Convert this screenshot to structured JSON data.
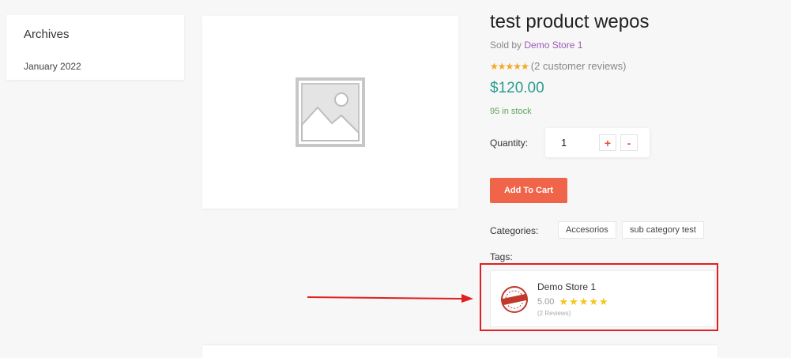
{
  "sidebar": {
    "title": "Archives",
    "items": [
      {
        "label": "January 2022"
      }
    ]
  },
  "product": {
    "title": "test product wepos",
    "sold_by_prefix": "Sold by",
    "vendor_link": "Demo Store 1",
    "rating_stars": 5,
    "reviews_text": "(2 customer reviews)",
    "price": "$120.00",
    "stock": "95 in stock",
    "quantity_label": "Quantity:",
    "quantity_value": "1",
    "plus_label": "+",
    "minus_label": "-",
    "add_to_cart": "Add To Cart",
    "categories_label": "Categories:",
    "categories": [
      "Accesorios",
      "sub category test"
    ],
    "tags_label": "Tags:"
  },
  "vendor_card": {
    "name": "Demo Store 1",
    "rating": "5.00",
    "stars": 5,
    "reviews": "(2 Reviews)",
    "logo_icon": "auction-badge-icon"
  },
  "colors": {
    "accent": "#f06449",
    "price": "#2a9d8f",
    "stock": "#5fa55a",
    "vendor_link": "#9b59b6",
    "highlight": "#e02020",
    "star": "#f5a623"
  }
}
